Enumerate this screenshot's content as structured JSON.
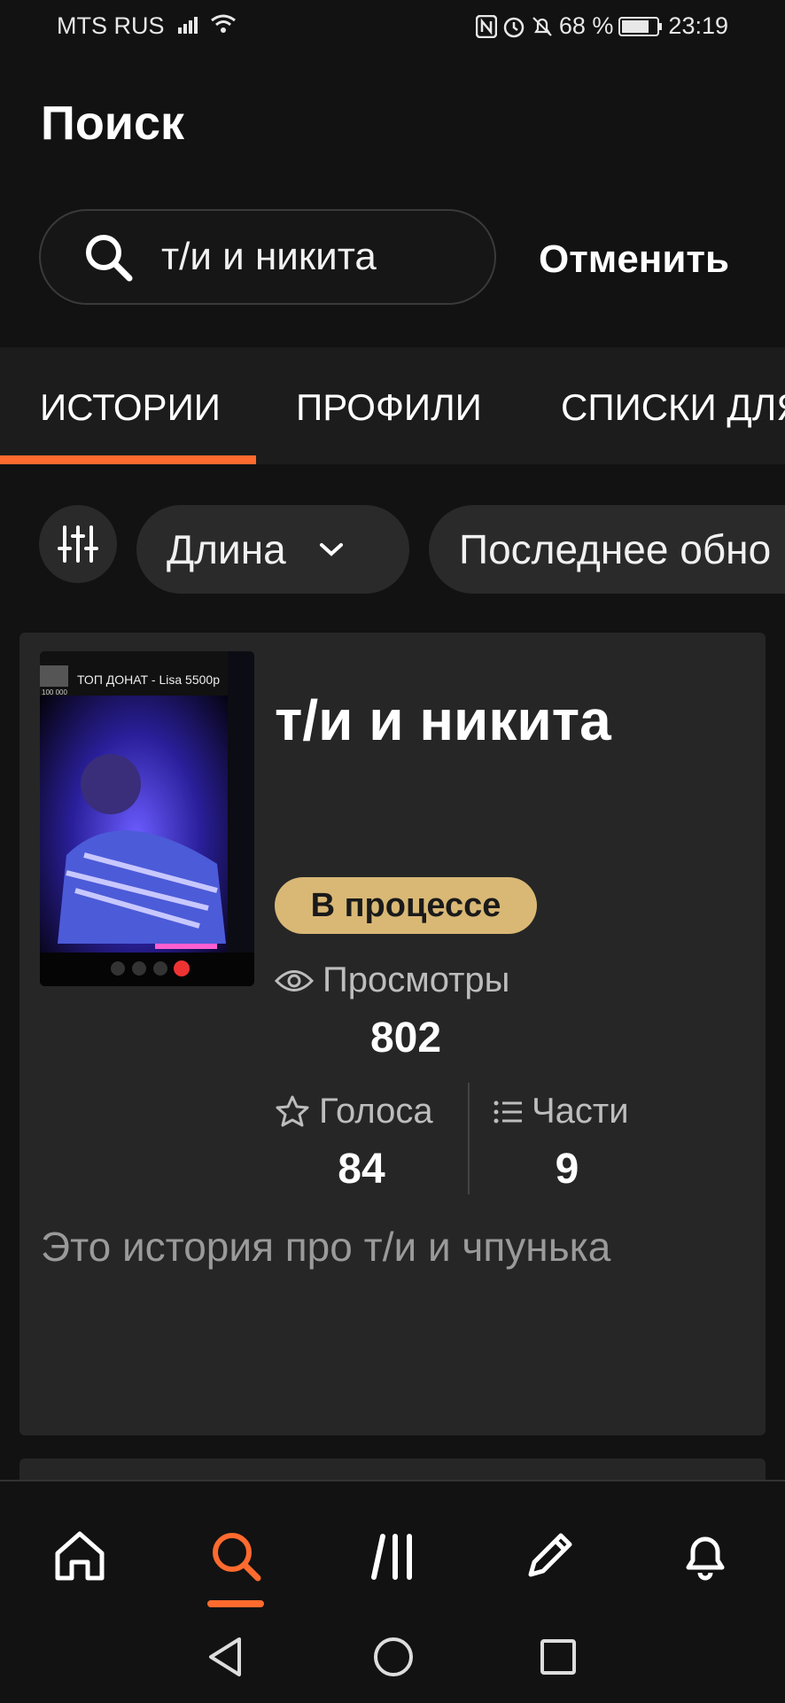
{
  "status_bar": {
    "carrier": "MTS RUS",
    "battery": "68 %",
    "time": "23:19"
  },
  "header": {
    "title": "Поиск",
    "search_value": "т/и и никита",
    "cancel_label": "Отменить"
  },
  "tabs": [
    {
      "label": "ИСТОРИИ",
      "active": true
    },
    {
      "label": "ПРОФИЛИ",
      "active": false
    },
    {
      "label": "СПИСКИ ДЛЯ",
      "active": false
    }
  ],
  "filters": {
    "length_label": "Длина",
    "updated_label": "Последнее обно"
  },
  "result": {
    "cover_caption": "ТОП ДОНАТ - Lisa 5500р",
    "cover_small_text": "100 000",
    "title": "т/и и никита",
    "status_badge": "В процессе",
    "views_label": "Просмотры",
    "views_value": "802",
    "votes_label": "Голоса",
    "votes_value": "84",
    "parts_label": "Части",
    "parts_value": "9",
    "description": "Это история про т/и и чпунька"
  },
  "colors": {
    "accent": "#ff6a2e",
    "badge": "#d9b876",
    "background": "#121212",
    "card": "#262626"
  },
  "nav": {
    "items": [
      "home-icon",
      "search-icon",
      "library-icon",
      "write-icon",
      "notifications-icon"
    ],
    "active": "search-icon"
  }
}
